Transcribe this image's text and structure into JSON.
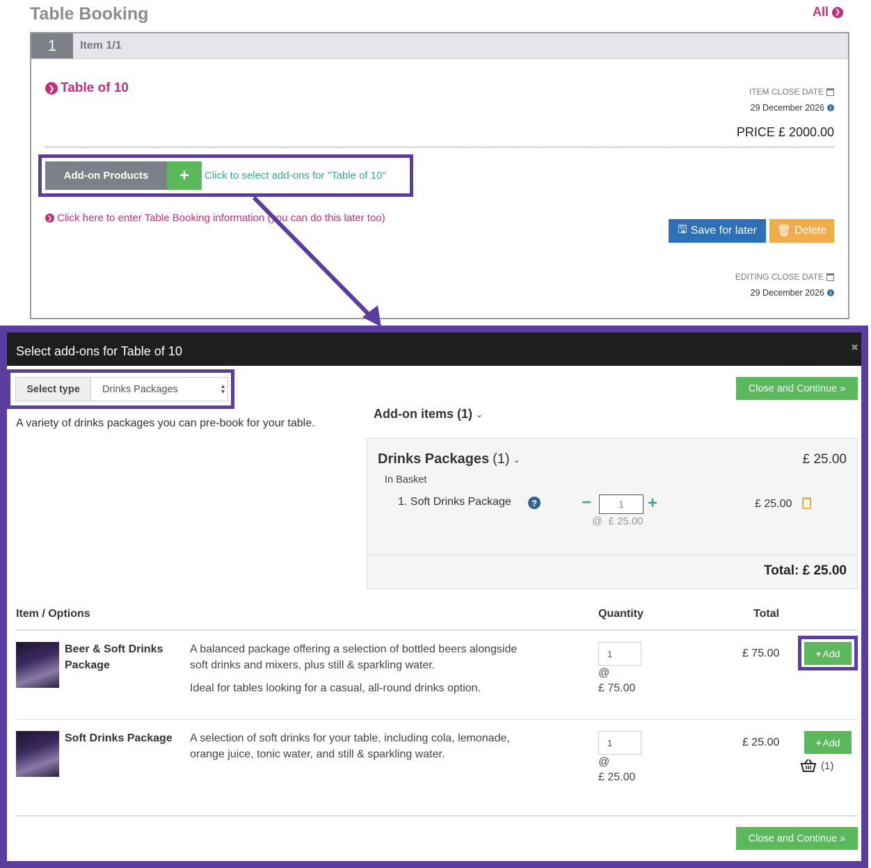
{
  "page": {
    "title": "Table Booking",
    "all_link": "All"
  },
  "item": {
    "number": "1",
    "label": "Item 1/1",
    "name": "Table of 10",
    "close_date_label": "ITEM CLOSE DATE",
    "close_date": "29 December 2026",
    "price": "PRICE £ 2000.00",
    "addon_button": "Add-on Products",
    "addon_hint": "Click to select add-ons for \"Table of 10\"",
    "enter_info": "Click here to enter Table Booking information (you can do this later too)",
    "save_label": "Save for later",
    "delete_label": "Delete",
    "editing_close_label": "EDITING CLOSE DATE",
    "editing_close_date": "29 December 2026"
  },
  "modal": {
    "title": "Select add-ons for Table of 10",
    "select_type_label": "Select type",
    "select_type_value": "Drinks Packages",
    "description": "A variety of drinks packages you can pre-book for your table.",
    "close_continue": "Close and Continue »",
    "addon_items": "Add-on items (1)",
    "basket": {
      "category": "Drinks Packages",
      "category_count": "(1)",
      "category_price": "£ 25.00",
      "in_basket": "In Basket",
      "item_name": "1. Soft Drinks Package",
      "item_qty": "1",
      "item_at": "@  £ 25.00",
      "item_price": "£ 25.00",
      "total": "Total: £ 25.00"
    },
    "table": {
      "col_item": "Item / Options",
      "col_qty": "Quantity",
      "col_total": "Total",
      "rows": [
        {
          "name_line1": "Beer & Soft Drinks",
          "name_line2": "Package",
          "desc_line1": "A balanced package offering a selection of bottled beers alongside",
          "desc_line2": "soft drinks and mixers, plus still & sparkling water.",
          "desc_line3": "Ideal for tables looking for a casual, all-round drinks option.",
          "qty": "1",
          "at": "@",
          "unit": "£ 75.00",
          "total": "£ 75.00",
          "add": "Add"
        },
        {
          "name_line1": "Soft Drinks Package",
          "desc_line1": "A selection of soft drinks for your table, including cola, lemonade,",
          "desc_line2": "orange juice, tonic water, and still & sparkling water.",
          "qty": "1",
          "at": "@",
          "unit": "£ 25.00",
          "total": "£ 25.00",
          "add": "Add",
          "in_cart": "(1)"
        }
      ]
    }
  },
  "colors": {
    "highlight": "#5a3d9c",
    "brand_pink": "#c0307d",
    "success": "#5cb85c",
    "primary": "#2f6fb5",
    "warning": "#f0ad4e",
    "teal": "#3aa59a"
  }
}
